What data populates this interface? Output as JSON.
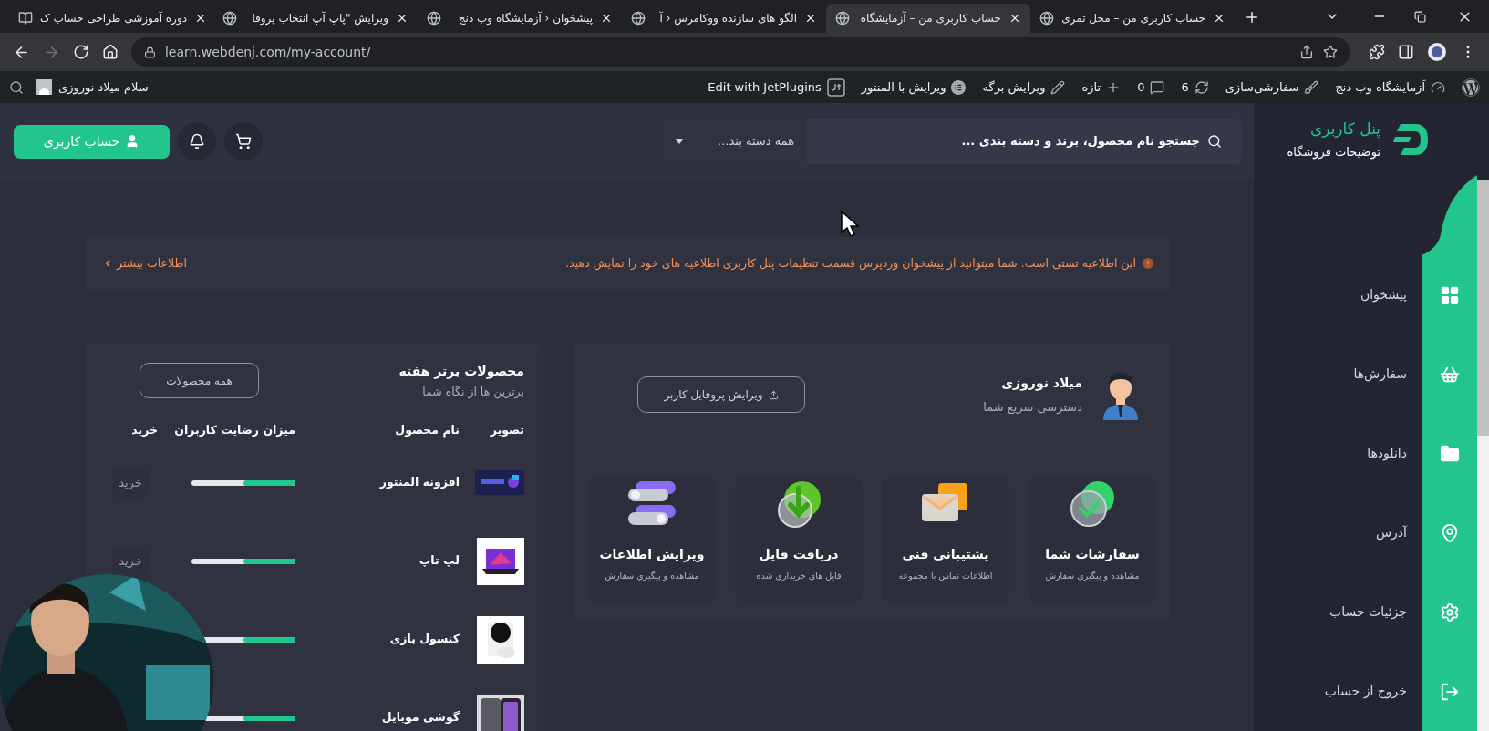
{
  "browser": {
    "tabs": [
      {
        "title": "حساب کاربری من – محل تمری",
        "selected": false,
        "kind": "globe"
      },
      {
        "title": "حساب کاربری من – آزمایشگاه",
        "selected": true,
        "kind": "globe"
      },
      {
        "title": "الگو های سازنده ووکامرس ‹ آ",
        "selected": false,
        "kind": "globe"
      },
      {
        "title": "پیشخوان ‹ آزمایشگاه وب دنج",
        "selected": false,
        "kind": "globe"
      },
      {
        "title": "ویرایش \"پاپ آپ انتخاب پروفا",
        "selected": false,
        "kind": "globe"
      },
      {
        "title": "دوره آموزشی طراحی حساب ک",
        "selected": false,
        "kind": "course"
      }
    ],
    "url": "learn.webdenj.com/my-account/",
    "forward_disabled": true
  },
  "admin_bar": {
    "items": [
      {
        "kind": "site",
        "label": "آزمایشگاه وب دنج"
      },
      {
        "kind": "customize",
        "label": "سفارشی‌سازی"
      },
      {
        "kind": "updates",
        "label": "6"
      },
      {
        "kind": "comments",
        "label": "0"
      },
      {
        "kind": "new",
        "label": "تازه"
      },
      {
        "kind": "edit",
        "label": "ویرایش برگه"
      },
      {
        "kind": "elementor",
        "label": "ویرایش با المنتور"
      },
      {
        "kind": "jet",
        "label": "Edit with JetPlugins"
      }
    ],
    "greeting": "سلام میلاد نوروزی"
  },
  "sidebar": {
    "title": "پنل کاربری",
    "subtitle": "توضیحات فروشگاه",
    "items": [
      {
        "kind": "dashboard",
        "label": "پیشخوان"
      },
      {
        "kind": "orders",
        "label": "سفارش‌ها"
      },
      {
        "kind": "downloads",
        "label": "دانلودها"
      },
      {
        "kind": "address",
        "label": "آدرس"
      },
      {
        "kind": "account",
        "label": "جزئیات حساب"
      },
      {
        "kind": "logout",
        "label": "خروج از حساب"
      }
    ]
  },
  "header": {
    "search": {
      "placeholder": "جستجو نام محصول، برند و دسته بندی ..."
    },
    "category": "همه دسته بند...",
    "account_button": "حساب کاربری"
  },
  "notice": {
    "text": "این اطلاعیه تستی است. شما میتوانید از پیشخوان وردپرس قسمت تنظیمات پنل کاربری اطلاعیه های خود را نمایش دهید.",
    "link": "اطلاعات بیشتر"
  },
  "profile_card": {
    "name": "میلاد نوروزی",
    "subtitle": "دسترسی سریع شما",
    "edit_button": "ویرایش پروفایل کاربر",
    "tiles": [
      {
        "kind": "orders",
        "title": "سفارشات شما",
        "subtitle": "مشاهده و پیگیری سفارش"
      },
      {
        "kind": "support",
        "title": "پشتیبانی فنی",
        "subtitle": "اطلاعات تماس با مجموعه"
      },
      {
        "kind": "download",
        "title": "دریافت فایل",
        "subtitle": "فایل های خریداری شده"
      },
      {
        "kind": "edit",
        "title": "ویرایش اطلاعات",
        "subtitle": "مشاهده و پیگیری سفارش"
      }
    ]
  },
  "products": {
    "title": "محصولات برتر هفته",
    "subtitle": "برترین ها از نگاه شما",
    "all_button": "همه محصولات",
    "columns": [
      "تصویر",
      "نام محصول",
      "میزان رضایت کاربران",
      "خرید"
    ],
    "rows": [
      {
        "kind": "banner",
        "name": "افزونه المنتور",
        "level": 0.5,
        "buy": "خرید"
      },
      {
        "kind": "laptop",
        "name": "لپ تاپ",
        "level": 0.5,
        "buy": "خرید"
      },
      {
        "kind": "console",
        "name": "کنسول بازی",
        "level": 0.5
      },
      {
        "kind": "phone",
        "name": "گوشی موبایل",
        "level": 0.5
      }
    ]
  }
}
